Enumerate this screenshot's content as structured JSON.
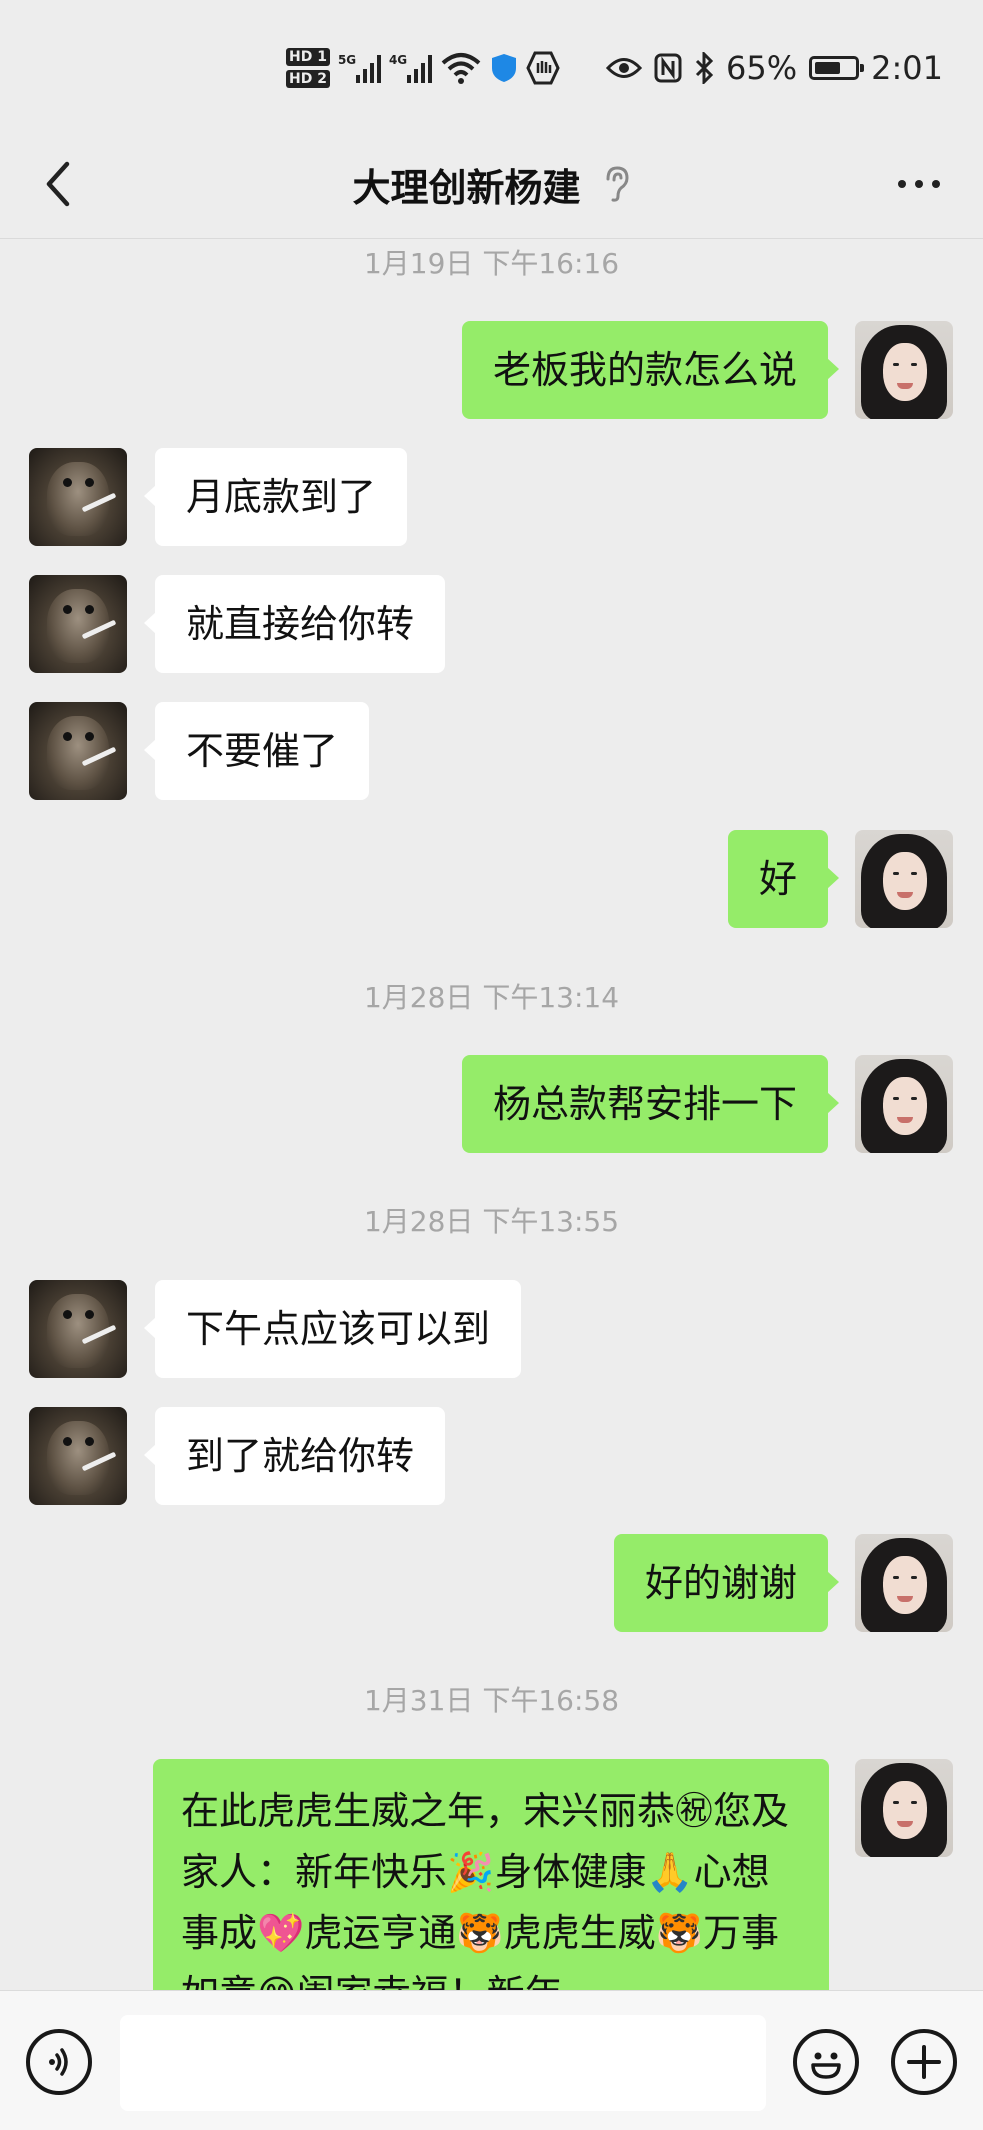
{
  "status_bar": {
    "sim1": "HD 1",
    "sim2": "HD 2",
    "net1": "5G",
    "net2": "4G",
    "wifi_tag": "6",
    "battery": "65%",
    "battery_level": 0.65,
    "time": "2:01"
  },
  "nav": {
    "title": "大理创新杨建",
    "back_icon": "chevron-left-icon",
    "ear_icon": "ear-icon",
    "more_icon": "more-dots-icon"
  },
  "messages": {
    "ts1": "1月19日 下午16:16",
    "m1": "老板我的款怎么说",
    "m2": "月底款到了",
    "m3": "就直接给你转",
    "m4": "不要催了",
    "m5": "好",
    "ts2": "1月28日 下午13:14",
    "m6": "杨总款帮安排一下",
    "ts3": "1月28日 下午13:55",
    "m7": "下午点应该可以到",
    "m8": "到了就给你转",
    "m9": "好的谢谢",
    "ts4": "1月31日 下午16:58",
    "m10": "在此虎虎生威之年，宋兴丽恭㊗您及家人：新年快乐🎉身体健康🙏心想事成💖虎运亨通🐯虎虎生威🐯万事如意😊阖家幸福！新年"
  },
  "input_bar": {
    "voice_icon": "voice-icon",
    "emoji_icon": "emoji-icon",
    "plus_icon": "plus-icon",
    "text_value": ""
  },
  "colors": {
    "background": "#ededed",
    "bubble_out": "#95ec69",
    "bubble_in": "#ffffff",
    "timestamp": "#a6a6a6"
  }
}
